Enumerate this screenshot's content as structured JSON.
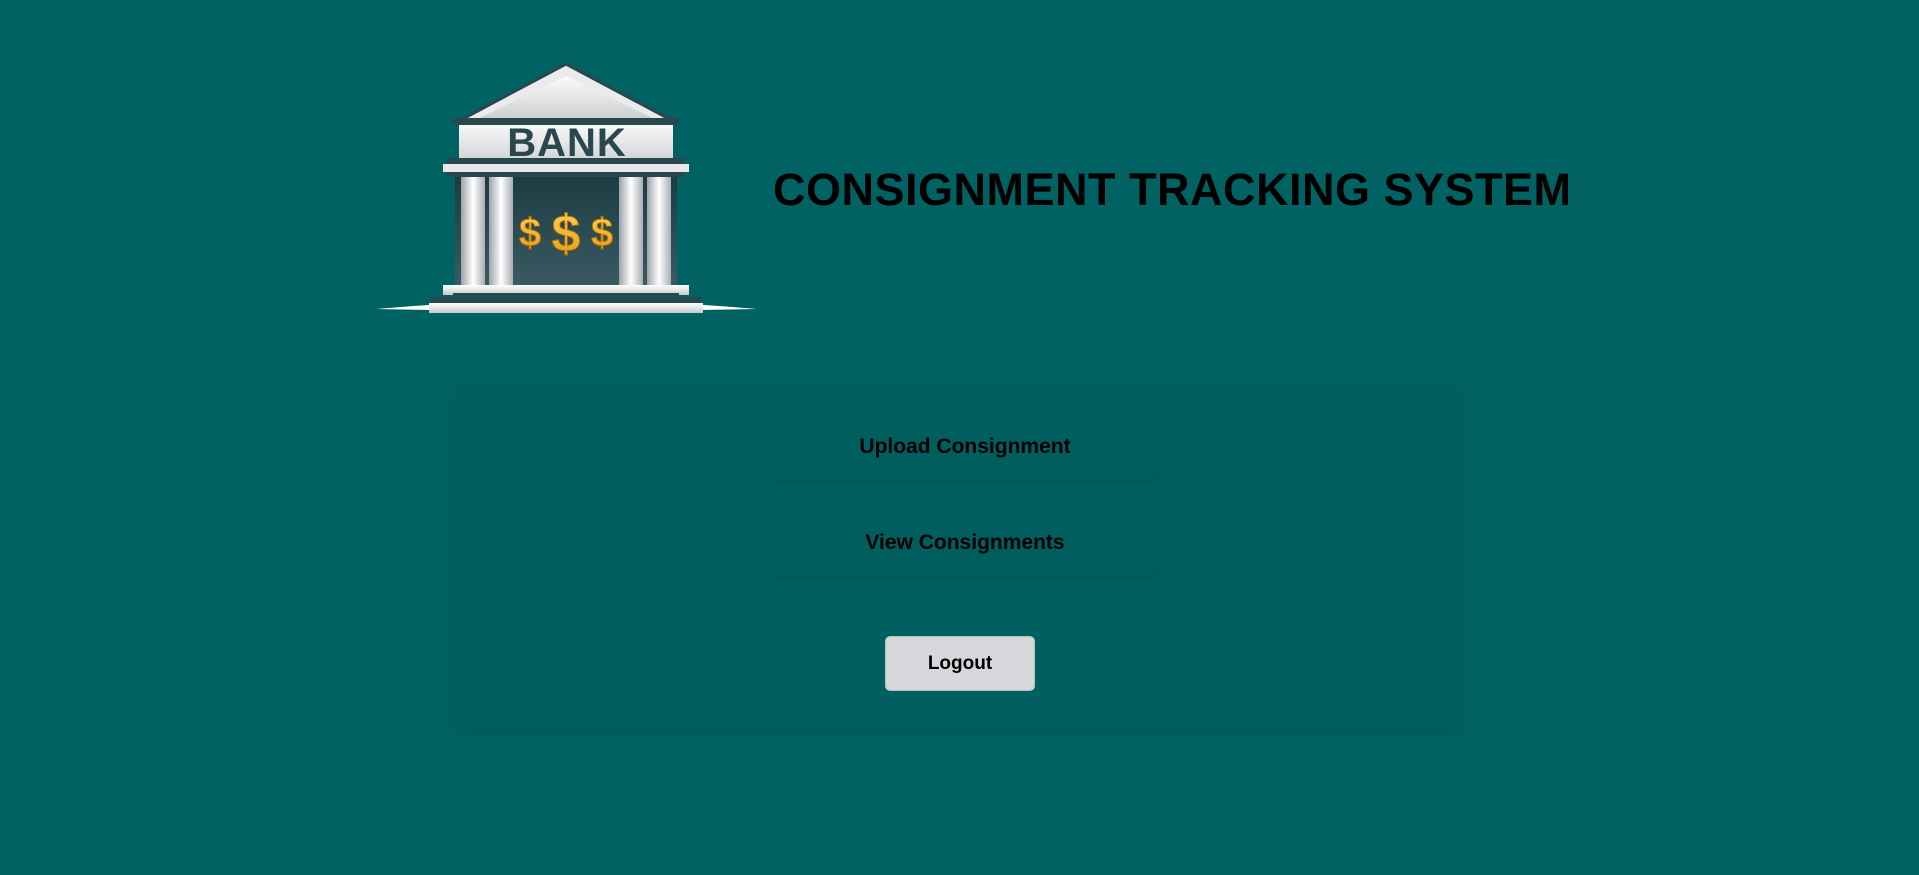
{
  "header": {
    "logo": {
      "icon": "bank-building-icon",
      "sign_text": "BANK",
      "symbols": [
        "$",
        "$",
        "$"
      ]
    },
    "title": "CONSIGNMENT TRACKING SYSTEM"
  },
  "menu": {
    "upload_label": "Upload Consignment",
    "view_label": "View Consignments",
    "logout_label": "Logout"
  },
  "colors": {
    "background": "#006262",
    "logout_button": "#d5d7da",
    "dollar_gold": "#f0b429"
  }
}
